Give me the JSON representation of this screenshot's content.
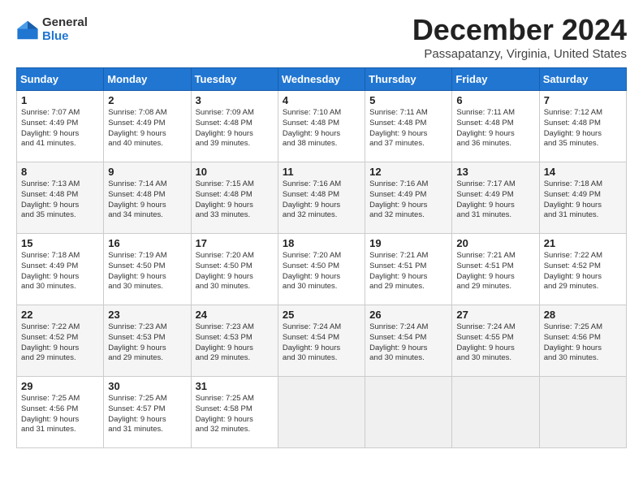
{
  "header": {
    "logo_general": "General",
    "logo_blue": "Blue",
    "title": "December 2024",
    "location": "Passapatanzy, Virginia, United States"
  },
  "days_of_week": [
    "Sunday",
    "Monday",
    "Tuesday",
    "Wednesday",
    "Thursday",
    "Friday",
    "Saturday"
  ],
  "weeks": [
    [
      {
        "day": "1",
        "sunrise": "7:07 AM",
        "sunset": "4:49 PM",
        "daylight": "9 hours and 41 minutes."
      },
      {
        "day": "2",
        "sunrise": "7:08 AM",
        "sunset": "4:49 PM",
        "daylight": "9 hours and 40 minutes."
      },
      {
        "day": "3",
        "sunrise": "7:09 AM",
        "sunset": "4:48 PM",
        "daylight": "9 hours and 39 minutes."
      },
      {
        "day": "4",
        "sunrise": "7:10 AM",
        "sunset": "4:48 PM",
        "daylight": "9 hours and 38 minutes."
      },
      {
        "day": "5",
        "sunrise": "7:11 AM",
        "sunset": "4:48 PM",
        "daylight": "9 hours and 37 minutes."
      },
      {
        "day": "6",
        "sunrise": "7:11 AM",
        "sunset": "4:48 PM",
        "daylight": "9 hours and 36 minutes."
      },
      {
        "day": "7",
        "sunrise": "7:12 AM",
        "sunset": "4:48 PM",
        "daylight": "9 hours and 35 minutes."
      }
    ],
    [
      {
        "day": "8",
        "sunrise": "7:13 AM",
        "sunset": "4:48 PM",
        "daylight": "9 hours and 35 minutes."
      },
      {
        "day": "9",
        "sunrise": "7:14 AM",
        "sunset": "4:48 PM",
        "daylight": "9 hours and 34 minutes."
      },
      {
        "day": "10",
        "sunrise": "7:15 AM",
        "sunset": "4:48 PM",
        "daylight": "9 hours and 33 minutes."
      },
      {
        "day": "11",
        "sunrise": "7:16 AM",
        "sunset": "4:48 PM",
        "daylight": "9 hours and 32 minutes."
      },
      {
        "day": "12",
        "sunrise": "7:16 AM",
        "sunset": "4:49 PM",
        "daylight": "9 hours and 32 minutes."
      },
      {
        "day": "13",
        "sunrise": "7:17 AM",
        "sunset": "4:49 PM",
        "daylight": "9 hours and 31 minutes."
      },
      {
        "day": "14",
        "sunrise": "7:18 AM",
        "sunset": "4:49 PM",
        "daylight": "9 hours and 31 minutes."
      }
    ],
    [
      {
        "day": "15",
        "sunrise": "7:18 AM",
        "sunset": "4:49 PM",
        "daylight": "9 hours and 30 minutes."
      },
      {
        "day": "16",
        "sunrise": "7:19 AM",
        "sunset": "4:50 PM",
        "daylight": "9 hours and 30 minutes."
      },
      {
        "day": "17",
        "sunrise": "7:20 AM",
        "sunset": "4:50 PM",
        "daylight": "9 hours and 30 minutes."
      },
      {
        "day": "18",
        "sunrise": "7:20 AM",
        "sunset": "4:50 PM",
        "daylight": "9 hours and 30 minutes."
      },
      {
        "day": "19",
        "sunrise": "7:21 AM",
        "sunset": "4:51 PM",
        "daylight": "9 hours and 29 minutes."
      },
      {
        "day": "20",
        "sunrise": "7:21 AM",
        "sunset": "4:51 PM",
        "daylight": "9 hours and 29 minutes."
      },
      {
        "day": "21",
        "sunrise": "7:22 AM",
        "sunset": "4:52 PM",
        "daylight": "9 hours and 29 minutes."
      }
    ],
    [
      {
        "day": "22",
        "sunrise": "7:22 AM",
        "sunset": "4:52 PM",
        "daylight": "9 hours and 29 minutes."
      },
      {
        "day": "23",
        "sunrise": "7:23 AM",
        "sunset": "4:53 PM",
        "daylight": "9 hours and 29 minutes."
      },
      {
        "day": "24",
        "sunrise": "7:23 AM",
        "sunset": "4:53 PM",
        "daylight": "9 hours and 29 minutes."
      },
      {
        "day": "25",
        "sunrise": "7:24 AM",
        "sunset": "4:54 PM",
        "daylight": "9 hours and 30 minutes."
      },
      {
        "day": "26",
        "sunrise": "7:24 AM",
        "sunset": "4:54 PM",
        "daylight": "9 hours and 30 minutes."
      },
      {
        "day": "27",
        "sunrise": "7:24 AM",
        "sunset": "4:55 PM",
        "daylight": "9 hours and 30 minutes."
      },
      {
        "day": "28",
        "sunrise": "7:25 AM",
        "sunset": "4:56 PM",
        "daylight": "9 hours and 30 minutes."
      }
    ],
    [
      {
        "day": "29",
        "sunrise": "7:25 AM",
        "sunset": "4:56 PM",
        "daylight": "9 hours and 31 minutes."
      },
      {
        "day": "30",
        "sunrise": "7:25 AM",
        "sunset": "4:57 PM",
        "daylight": "9 hours and 31 minutes."
      },
      {
        "day": "31",
        "sunrise": "7:25 AM",
        "sunset": "4:58 PM",
        "daylight": "9 hours and 32 minutes."
      },
      null,
      null,
      null,
      null
    ]
  ],
  "labels": {
    "sunrise": "Sunrise:",
    "sunset": "Sunset:",
    "daylight": "Daylight:"
  }
}
